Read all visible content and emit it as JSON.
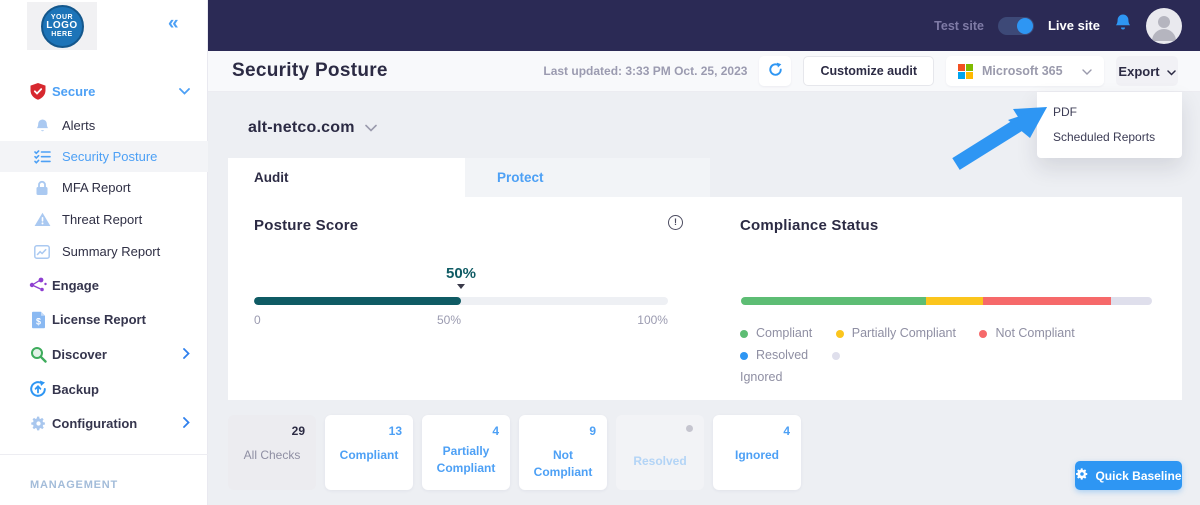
{
  "colors": {
    "topbar_bg": "#2b2a55",
    "accent_blue": "#2e96f3",
    "sidebar_link_blue": "#4da0f5",
    "posture_teal": "#0f5b64",
    "compliant_green": "#5dbd74",
    "partial_yellow": "#fbc51d",
    "noncompliant_red": "#f6696a",
    "ignored_lavender": "#dfdfec"
  },
  "sidebar": {
    "logo": {
      "line1": "YOUR",
      "line2": "LOGO",
      "line3": "HERE"
    },
    "secure": "Secure",
    "alerts": "Alerts",
    "security_posture": "Security Posture",
    "mfa_report": "MFA Report",
    "threat_report": "Threat Report",
    "summary_report": "Summary Report",
    "engage": "Engage",
    "license_report": "License Report",
    "discover": "Discover",
    "backup": "Backup",
    "configuration": "Configuration",
    "management": "MANAGEMENT"
  },
  "topbar": {
    "test_site": "Test site",
    "live_site": "Live site"
  },
  "header": {
    "title": "Security Posture",
    "last_updated": "Last updated: 3:33 PM Oct. 25, 2023",
    "customize_button": "Customize audit",
    "integration": "Microsoft 365",
    "export_button": "Export"
  },
  "export_menu": {
    "items": [
      "PDF",
      "Scheduled Reports"
    ]
  },
  "main": {
    "site_name": "alt-netco.com",
    "tabs": {
      "audit": "Audit",
      "protect": "Protect"
    },
    "posture": {
      "title": "Posture Score",
      "score_label": "50%",
      "percent": 50,
      "fill_color": "#0f5b64",
      "tick_0": "0",
      "tick_50": "50%",
      "tick_100": "100%"
    },
    "compliance": {
      "title": "Compliance Status",
      "segments": [
        {
          "label": "Compliant",
          "percent": 45,
          "color": "#5dbd74"
        },
        {
          "label": "Partially Compliant",
          "percent": 14,
          "color": "#fbc51d"
        },
        {
          "label": "Not Compliant",
          "percent": 31,
          "color": "#f6696a"
        },
        {
          "label": "Ignored",
          "percent": 10,
          "color": "#dfdfec"
        }
      ],
      "legend": [
        {
          "label": "Compliant",
          "color": "#5dbd74"
        },
        {
          "label": "Partially Compliant",
          "color": "#fbc51d"
        },
        {
          "label": "Not Compliant",
          "color": "#f6696a"
        },
        {
          "label": "Resolved",
          "color": "#2e96f3"
        },
        {
          "label": "Ignored",
          "color": "#dfdfec"
        }
      ]
    },
    "cards": [
      {
        "count": "29",
        "label": "All Checks"
      },
      {
        "count": "13",
        "label": "Compliant"
      },
      {
        "count": "4",
        "label": "Partially Compliant"
      },
      {
        "count": "9",
        "label": "Not Compliant"
      },
      {
        "count": "",
        "label": "Resolved"
      },
      {
        "count": "4",
        "label": "Ignored"
      }
    ],
    "quick_baseline": "Quick Baseline"
  },
  "chart_data": [
    {
      "type": "bar",
      "title": "Posture Score",
      "values": [
        50
      ],
      "x_ticks": [
        "0",
        "50%",
        "100%"
      ],
      "xlim": [
        0,
        100
      ],
      "note": "horizontal progress gauge filled to 50%"
    },
    {
      "type": "bar",
      "title": "Compliance Status",
      "categories": [
        "Compliant",
        "Partially Compliant",
        "Not Compliant",
        "Resolved",
        "Ignored"
      ],
      "values": [
        13,
        4,
        9,
        0,
        4
      ],
      "note": "stacked horizontal bar of 29 checks; legend below bar"
    }
  ]
}
